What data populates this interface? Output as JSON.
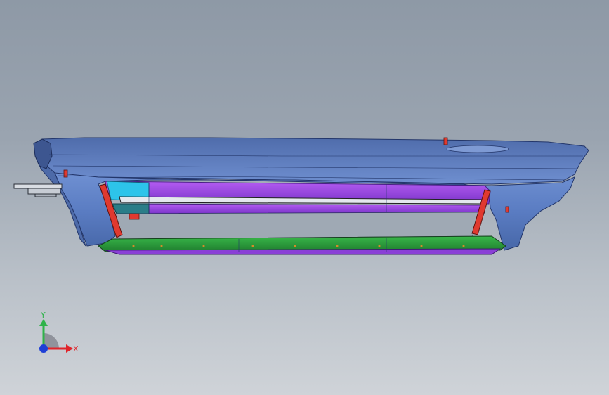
{
  "triad": {
    "y_label": "Y",
    "x_label": "X",
    "colors": {
      "x": "#e0242a",
      "y": "#2fb34a",
      "z": "#1e3fd6",
      "plane": "#7d8089"
    }
  },
  "model": {
    "colors": {
      "body": "#5f82c8",
      "body_dark": "#3f5f9e",
      "body_light": "#8ea8d8",
      "accent_purple": "#a64fe6",
      "accent_purple_dark": "#6d2cb8",
      "accent_cyan": "#34c3e8",
      "accent_green": "#2fa83e",
      "accent_red": "#e0392f"
    },
    "icon": "bumper-3d-model"
  }
}
